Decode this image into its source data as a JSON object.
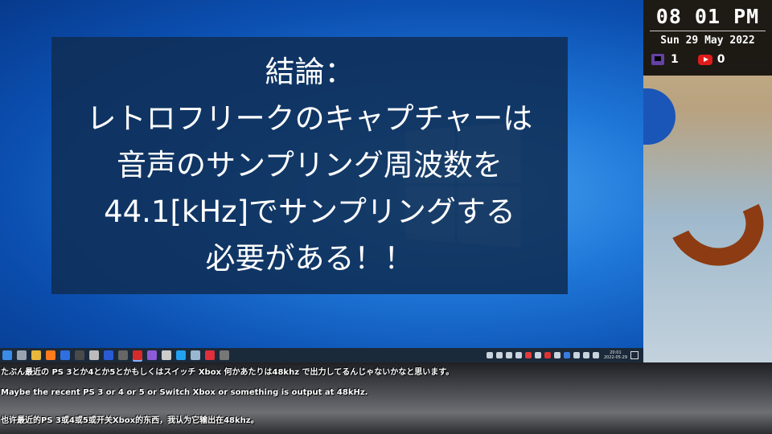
{
  "caption": {
    "lines": [
      "結論：",
      "レトロフリークのキャプチャーは",
      "音声のサンプリング周波数を",
      "44.1[kHz]でサンプリングする",
      "必要がある！！"
    ]
  },
  "clock_panel": {
    "time": "08 01 PM",
    "date": "Sun 29 May 2022",
    "twitch_count": "1",
    "youtube_count": "0"
  },
  "taskbar": {
    "icons": [
      "windows-start-icon",
      "task-view-icon",
      "file-explorer-icon",
      "firefox-icon",
      "app-icon",
      "terminal-icon",
      "film-icon",
      "bluetooth-icon",
      "camera-icon",
      "obs-icon",
      "app-icon",
      "app-icon",
      "vscode-icon",
      "app-icon",
      "app-icon",
      "app-icon"
    ],
    "colors": [
      "#3b8be8",
      "#9aa4b0",
      "#e8b73b",
      "#ff7a1a",
      "#2f6fe0",
      "#4a4a4a",
      "#bbbbbb",
      "#2a5bd7",
      "#666666",
      "#d62b2b",
      "#8e5bd8",
      "#cccccc",
      "#22a1f0",
      "#9ab6d0",
      "#e0303a",
      "#777777"
    ],
    "clock_time": "20:01",
    "clock_date": "2022-05-29"
  },
  "subtitles": {
    "ja": "たぶん最近の PS 3とか4とか5とかもしくはスイッチ Xbox 何かあたりは48khz で出力してるんじゃないかなと思います。",
    "en": "Maybe the recent PS 3 or 4 or 5 or Switch Xbox or something is output at 48kHz.",
    "zh": "也许最近的PS 3或4或5或开关Xbox的东西，我认为它输出在48khz。"
  }
}
